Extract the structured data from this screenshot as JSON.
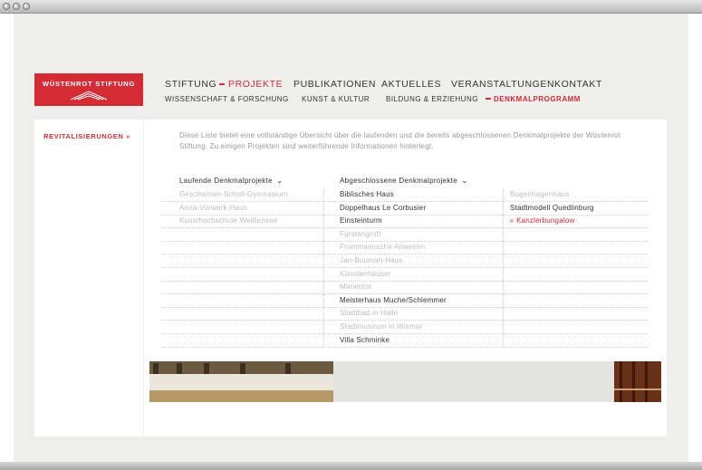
{
  "logo": {
    "text": "WÜSTENROT STIFTUNG"
  },
  "nav": {
    "primary": [
      {
        "label": "STIFTUNG",
        "active": false
      },
      {
        "label": "PROJEKTE",
        "active": true
      },
      {
        "label": "PUBLIKATIONEN",
        "active": false
      },
      {
        "label": "AKTUELLES",
        "active": false
      },
      {
        "label": "VERANSTALTUNGEN",
        "active": false
      },
      {
        "label": "KONTAKT",
        "active": false
      }
    ],
    "secondary": [
      {
        "label": "WISSENSCHAFT & FORSCHUNG",
        "active": false
      },
      {
        "label": "KUNST & KULTUR",
        "active": false
      },
      {
        "label": "BILDUNG & ERZIEHUNG",
        "active": false
      },
      {
        "label": "DENKMALPROGRAMM",
        "active": true
      }
    ]
  },
  "sidebar": {
    "link": "REVITALISIERUNGEN »"
  },
  "intro": "Diese Liste bietet eine vollständige Übersicht über die laufenden und die bereits abgeschlossenen Denkmalprojekte der Wüstenrot Stiftung. Zu einigen Projekten sind weiterführende Informationen hinterlegt.",
  "columns": {
    "laufende_header": "Laufende Denkmalprojekte",
    "abgeschlossene_header": "Abgeschlossene Denkmalprojekte",
    "chevron": "⌄"
  },
  "rows": [
    {
      "col1": "Geschwister-Scholl-Gymnasium",
      "col2": "Biblisches Haus",
      "col2_style": "dark",
      "col3": "Bugenhagenhaus",
      "col3_style": "gray"
    },
    {
      "col1": "Anna-Vorwerk-Haus",
      "col2": "Doppelhaus Le Corbusier",
      "col2_style": "dark",
      "col3": "Stadtmodell Quedlinburg",
      "col3_style": "dark"
    },
    {
      "col1": "Kunsthochschule Weißensee",
      "col2": "Einsteinturm",
      "col2_style": "dark",
      "col3": "« Kanzlerbungalow",
      "col3_style": "red"
    },
    {
      "col1": "",
      "col2": "Fürstengruft",
      "col2_style": "gray",
      "col3": "",
      "col3_style": "gray"
    },
    {
      "col1": "",
      "col2": "Frommannsche Anwesen",
      "col2_style": "gray",
      "col3": "",
      "col3_style": "gray"
    },
    {
      "col1": "",
      "col2": "Jan-Bouman-Haus",
      "col2_style": "gray",
      "col3": "",
      "col3_style": "gray"
    },
    {
      "col1": "",
      "col2": "Künstlerhäuser",
      "col2_style": "gray",
      "col3": "",
      "col3_style": "gray"
    },
    {
      "col1": "",
      "col2": "Marientor",
      "col2_style": "gray",
      "col3": "",
      "col3_style": "gray"
    },
    {
      "col1": "",
      "col2": "Meisterhaus Muche/Schlemmer",
      "col2_style": "dark",
      "col3": "",
      "col3_style": "gray"
    },
    {
      "col1": "",
      "col2": "Stadtbad in Halle",
      "col2_style": "gray",
      "col3": "",
      "col3_style": "gray"
    },
    {
      "col1": "",
      "col2": "Stadtmuseum in Wismar",
      "col2_style": "gray",
      "col3": "",
      "col3_style": "gray"
    },
    {
      "col1": "",
      "col2": "Villa Schminke",
      "col2_style": "dark",
      "col3": "",
      "col3_style": "gray"
    }
  ],
  "colors": {
    "accent": "#d42b35",
    "text": "#333333",
    "muted": "#bdbdbd"
  }
}
